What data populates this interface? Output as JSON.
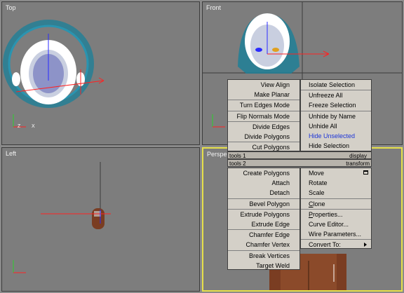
{
  "viewports": {
    "top": {
      "label": "Top"
    },
    "front": {
      "label": "Front"
    },
    "left": {
      "label": "Left"
    },
    "perspective": {
      "label": "Perspe"
    }
  },
  "axis_labels": {
    "z": "Z",
    "x": "X"
  },
  "quad_menu": {
    "tools1": {
      "header_left": "tools 1",
      "header_right": "display",
      "left_items": [
        "View Align",
        "Make Planar",
        "Turn Edges Mode",
        "Flip Normals Mode",
        "Divide Edges",
        "Divide Polygons",
        "Cut Polygons"
      ],
      "right_items": [
        "Isolate Selection",
        "Unfreeze All",
        "Freeze Selection",
        "Unhide by Name",
        "Unhide All",
        "Hide Unselected",
        "Hide Selection"
      ]
    },
    "tools2": {
      "header_left": "tools 2",
      "header_right": "transform",
      "left_items": [
        "Create Polygons",
        "Attach",
        "Detach",
        "Bevel Polygon",
        "Extrude Polygons",
        "Extrude Edge",
        "Chamfer Edge",
        "Chamfer Vertex",
        "Break Vertices",
        "Target Weld"
      ],
      "right_items": [
        "Move",
        "Rotate",
        "Scale",
        "Clone",
        "Properties...",
        "Curve Editor...",
        "Wire Parameters...",
        "Convert To:"
      ]
    }
  },
  "colors": {
    "active_viewport_border": "#e6e04a",
    "menu_bg": "#d4d0c8",
    "highlight_text": "#1c34d8",
    "mesh": "#1f7f97"
  }
}
